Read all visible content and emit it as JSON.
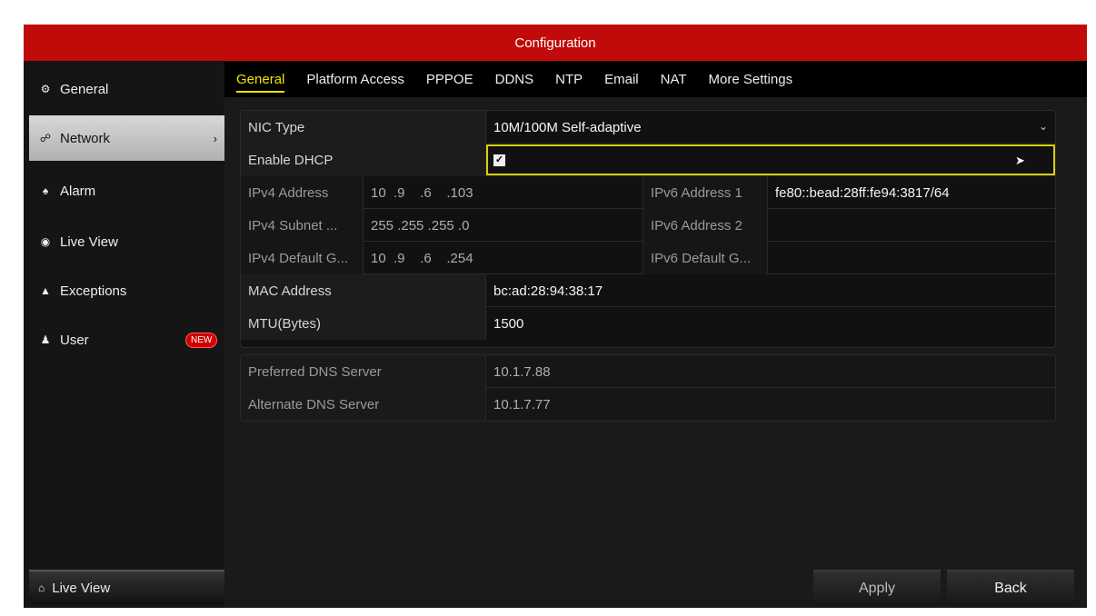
{
  "window": {
    "title": "Configuration"
  },
  "sidebar": {
    "items": [
      {
        "label": "General",
        "icon": "gear-icon"
      },
      {
        "label": "Network",
        "icon": "network-icon"
      },
      {
        "label": "Alarm",
        "icon": "alarm-icon"
      },
      {
        "label": "Live View",
        "icon": "eye-icon"
      },
      {
        "label": "Exceptions",
        "icon": "warning-icon"
      },
      {
        "label": "User",
        "icon": "users-icon",
        "badge": "NEW"
      }
    ],
    "bottom_live_view": "Live View"
  },
  "tabs": [
    "General",
    "Platform Access",
    "PPPOE",
    "DDNS",
    "NTP",
    "Email",
    "NAT",
    "More Settings"
  ],
  "form": {
    "nic_type": {
      "label": "NIC Type",
      "value": "10M/100M Self-adaptive"
    },
    "dhcp": {
      "label": "Enable DHCP",
      "checked": true
    },
    "ipv4_address": {
      "label": "IPv4 Address",
      "value": "10  .9    .6    .103"
    },
    "ipv4_subnet": {
      "label": "IPv4 Subnet ...",
      "value": "255 .255 .255 .0"
    },
    "ipv4_gateway": {
      "label": "IPv4 Default G...",
      "value": "10  .9    .6    .254"
    },
    "ipv6_address1": {
      "label": "IPv6 Address 1",
      "value": "fe80::bead:28ff:fe94:3817/64"
    },
    "ipv6_address2": {
      "label": "IPv6 Address 2",
      "value": ""
    },
    "ipv6_gateway": {
      "label": "IPv6 Default G...",
      "value": ""
    },
    "mac": {
      "label": "MAC Address",
      "value": "bc:ad:28:94:38:17"
    },
    "mtu": {
      "label": "MTU(Bytes)",
      "value": "1500"
    },
    "dns_pref": {
      "label": "Preferred DNS Server",
      "value": "10.1.7.88"
    },
    "dns_alt": {
      "label": "Alternate DNS Server",
      "value": "10.1.7.77"
    }
  },
  "buttons": {
    "apply": "Apply",
    "back": "Back"
  },
  "colors": {
    "titlebar": "#c10a0a",
    "active_tab": "#f2e400",
    "focus_border": "#d8cf10"
  }
}
